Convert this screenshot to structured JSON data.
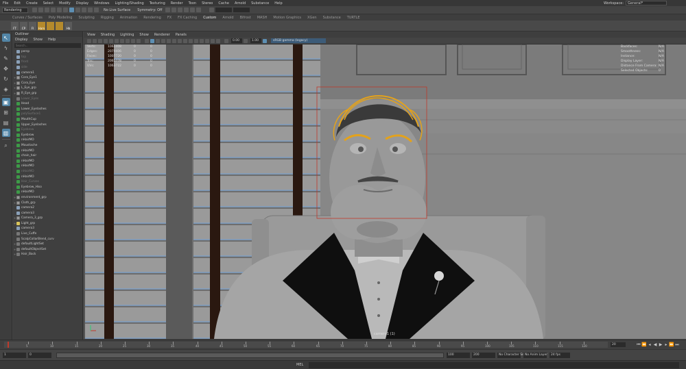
{
  "menubar": {
    "items": [
      "File",
      "Edit",
      "Create",
      "Select",
      "Modify",
      "Display",
      "Windows",
      "Lighting/Shading",
      "Texturing",
      "Render",
      "Toon",
      "Stereo",
      "Cache",
      "Arnold",
      "Substance",
      "Help"
    ],
    "workspace_label": "Workspace:",
    "workspace_value": "General*"
  },
  "statusline": {
    "mode": "Rendering",
    "live_surface": "No Live Surface",
    "symmetry": "Symmetry: Off"
  },
  "shelf": {
    "tabs": [
      "Curves / Surfaces",
      "Poly Modeling",
      "Sculpting",
      "Rigging",
      "Animation",
      "Rendering",
      "FX",
      "FX Caching",
      "Custom",
      "Arnold",
      "Bifrost",
      "MASH",
      "Motion Graphics",
      "XGen",
      "Substance",
      "TURTLE"
    ],
    "active_tab": "Custom",
    "buttons": [
      "FT",
      "CP",
      "FI",
      "Ham",
      "",
      "",
      "Hb"
    ]
  },
  "outliner": {
    "title": "Outliner",
    "menu": [
      "Display",
      "Show",
      "Help"
    ],
    "search_placeholder": "Search...",
    "items": [
      {
        "label": "persp",
        "icon": "cam",
        "dim": false,
        "expand": ""
      },
      {
        "label": "top",
        "icon": "cam",
        "dim": true,
        "expand": ""
      },
      {
        "label": "front",
        "icon": "cam",
        "dim": true,
        "expand": ""
      },
      {
        "label": "side",
        "icon": "cam",
        "dim": true,
        "expand": ""
      },
      {
        "label": "camera1",
        "icon": "cam",
        "dim": false,
        "expand": ""
      },
      {
        "label": "Cora_Eye1",
        "icon": "grp",
        "dim": false,
        "expand": "+"
      },
      {
        "label": "Cora_Eye",
        "icon": "grp",
        "dim": false,
        "expand": "+"
      },
      {
        "label": "L_Eye_grp",
        "icon": "grp",
        "dim": false,
        "expand": "+"
      },
      {
        "label": "R_Eye_grp",
        "icon": "grp",
        "dim": false,
        "expand": "+"
      },
      {
        "label": "Lower_Eyes",
        "icon": "grey",
        "dim": true,
        "expand": ""
      },
      {
        "label": "Head",
        "icon": "mesh",
        "dim": false,
        "expand": ""
      },
      {
        "label": "Lower_Eyelashes",
        "icon": "mesh",
        "dim": false,
        "expand": ""
      },
      {
        "label": "polySurface1",
        "icon": "mesh",
        "dim": true,
        "expand": ""
      },
      {
        "label": "MouthCup",
        "icon": "mesh",
        "dim": false,
        "expand": ""
      },
      {
        "label": "Upper_Eyelashes",
        "icon": "mesh",
        "dim": false,
        "expand": ""
      },
      {
        "label": "Eyebrow",
        "icon": "mesh",
        "dim": true,
        "expand": ""
      },
      {
        "label": "Eyebrow",
        "icon": "mesh",
        "dim": false,
        "expand": ""
      },
      {
        "label": "nHairMO",
        "icon": "mesh",
        "dim": false,
        "expand": ""
      },
      {
        "label": "Moustache",
        "icon": "mesh",
        "dim": false,
        "expand": ""
      },
      {
        "label": "nHairMO",
        "icon": "mesh",
        "dim": false,
        "expand": ""
      },
      {
        "label": "chain_hair",
        "icon": "mesh",
        "dim": false,
        "expand": ""
      },
      {
        "label": "nHairMO",
        "icon": "mesh",
        "dim": false,
        "expand": ""
      },
      {
        "label": "nHairMO",
        "icon": "mesh",
        "dim": false,
        "expand": ""
      },
      {
        "label": "nHairMO",
        "icon": "mesh",
        "dim": true,
        "expand": ""
      },
      {
        "label": "nHairMO",
        "icon": "mesh",
        "dim": false,
        "expand": ""
      },
      {
        "label": "Hair_Curves",
        "icon": "mesh",
        "dim": true,
        "expand": ""
      },
      {
        "label": "Eyebrow_Hiso",
        "icon": "mesh",
        "dim": false,
        "expand": ""
      },
      {
        "label": "nHairMO",
        "icon": "mesh",
        "dim": false,
        "expand": ""
      },
      {
        "label": "environment_grp",
        "icon": "grp",
        "dim": false,
        "expand": "+"
      },
      {
        "label": "Cloth_grp",
        "icon": "grp",
        "dim": false,
        "expand": "+"
      },
      {
        "label": "camera2",
        "icon": "cam",
        "dim": false,
        "expand": ""
      },
      {
        "label": "camera3",
        "icon": "cam",
        "dim": false,
        "expand": ""
      },
      {
        "label": "Camera_3_grp",
        "icon": "grp",
        "dim": false,
        "expand": "+"
      },
      {
        "label": "Light_grp",
        "icon": "light",
        "dim": false,
        "expand": "+"
      },
      {
        "label": "camera3",
        "icon": "cam",
        "dim": false,
        "expand": ""
      },
      {
        "label": "Live_Cuffe",
        "icon": "grey",
        "dim": false,
        "expand": ""
      },
      {
        "label": "ScalpCollarBlend_curv",
        "icon": "grey",
        "dim": false,
        "expand": ""
      },
      {
        "label": "defaultLightSet",
        "icon": "grey",
        "dim": false,
        "expand": "+"
      },
      {
        "label": "defaultObjectSet",
        "icon": "grey",
        "dim": false,
        "expand": "+"
      },
      {
        "label": "Hair_Back",
        "icon": "grey",
        "dim": false,
        "expand": "+"
      }
    ]
  },
  "viewport": {
    "menu": [
      "View",
      "Shading",
      "Lighting",
      "Show",
      "Renderer",
      "Panels"
    ],
    "near_value": "0.00",
    "far_value": "1.00",
    "color_space": "sRGB gamma (legacy)",
    "camera_label": "camera1 (1)",
    "hud_left": [
      {
        "k": "Verts:",
        "v": "1061408",
        "c": "0",
        "d": "0"
      },
      {
        "k": "Edges:",
        "v": "2079406",
        "c": "0",
        "d": "0"
      },
      {
        "k": "Faces:",
        "v": "1007720",
        "c": "0",
        "d": "0"
      },
      {
        "k": "Tris:",
        "v": "2065778",
        "c": "0",
        "d": "0"
      },
      {
        "k": "UVs:",
        "v": "1063722",
        "c": "0",
        "d": "0"
      }
    ],
    "hud_right": [
      {
        "k": "Backfaces:",
        "v": "N/A"
      },
      {
        "k": "Smoothness:",
        "v": "N/A"
      },
      {
        "k": "Instance:",
        "v": "N/A"
      },
      {
        "k": "Display Layer:",
        "v": "N/A"
      },
      {
        "k": "Distance From Camera:",
        "v": "N/A"
      },
      {
        "k": "Selected Objects:",
        "v": "0"
      }
    ]
  },
  "timeslider": {
    "ticks": [
      "5",
      "10",
      "15",
      "20",
      "25",
      "30",
      "35",
      "40",
      "45",
      "50",
      "55",
      "60",
      "65",
      "70",
      "75",
      "80",
      "85",
      "90",
      "95",
      "100",
      "105",
      "110",
      "115",
      "120"
    ],
    "current_frame": "20"
  },
  "rangeslider": {
    "start": "1",
    "start_inner": "0",
    "range_label": "",
    "end_inner": "100",
    "end": "200",
    "char_set": "No Character Set",
    "anim_layer": "No Anim Layer",
    "fps": "24 fps"
  },
  "cmdline": {
    "label": "MEL"
  }
}
